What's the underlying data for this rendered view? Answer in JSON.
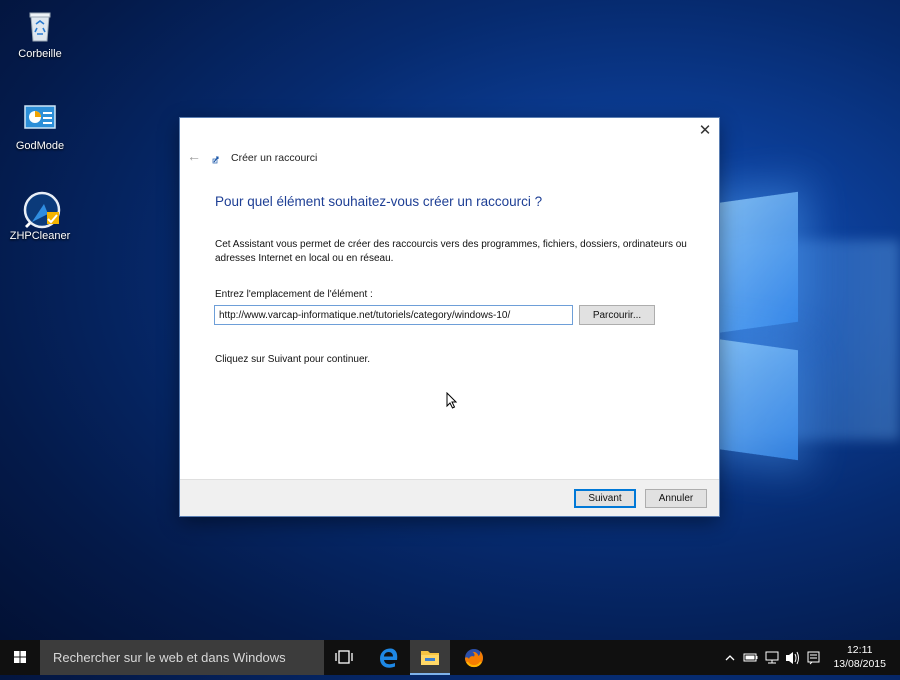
{
  "desktop": {
    "icons": [
      {
        "label": "Corbeille",
        "icon": "recycle-bin-icon"
      },
      {
        "label": "GodMode",
        "icon": "control-panel-icon"
      },
      {
        "label": "ZHPCleaner",
        "icon": "zhpcleaner-icon"
      }
    ]
  },
  "dialog": {
    "close_glyph": "✕",
    "back_glyph": "←",
    "title": "Créer un raccourci",
    "heading": "Pour quel élément souhaitez-vous créer un raccourci ?",
    "description": "Cet Assistant vous permet de créer des raccourcis vers des programmes, fichiers, dossiers, ordinateurs ou adresses Internet en local ou en réseau.",
    "location_label": "Entrez l'emplacement de l'élément :",
    "location_value": "http://www.varcap-informatique.net/tutoriels/category/windows-10/",
    "browse_label": "Parcourir...",
    "hint": "Cliquez sur Suivant pour continuer.",
    "next_label": "Suivant",
    "cancel_label": "Annuler"
  },
  "taskbar": {
    "search_placeholder": "Rechercher sur le web et dans Windows",
    "apps": [
      "task-view-icon",
      "edge-icon",
      "file-explorer-icon",
      "firefox-icon"
    ],
    "clock_time": "12:11",
    "clock_date": "13/08/2015"
  },
  "colors": {
    "accent": "#0078d7",
    "heading": "#1e3f95",
    "taskbar": "#101010"
  }
}
